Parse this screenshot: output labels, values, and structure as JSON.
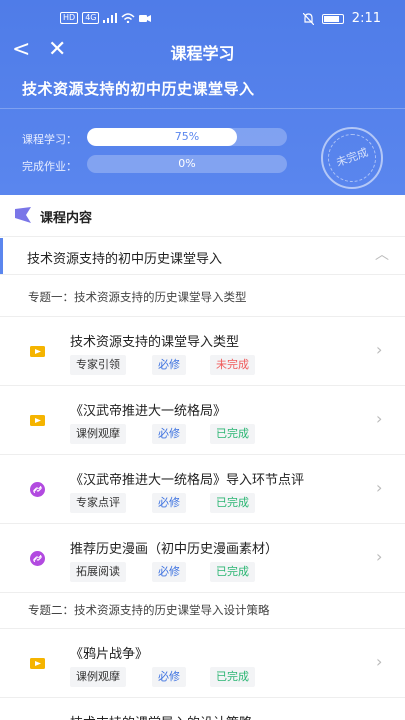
{
  "status_bar": {
    "chip1": "HD",
    "chip2": "4G",
    "time": "2:11"
  },
  "nav": {
    "back_glyph": "<",
    "close_glyph": "✕",
    "title": "课程学习"
  },
  "course": {
    "title": "技术资源支持的初中历史课堂导入",
    "progress": [
      {
        "label": "课程学习：",
        "value_text": "75%",
        "fraction": 0.75
      },
      {
        "label": "完成作业：",
        "value_text": "0%",
        "fraction": 0
      }
    ],
    "stamp": "未完成"
  },
  "section": {
    "title": "课程内容",
    "icon": "flag-icon"
  },
  "chapter": {
    "title": "技术资源支持的初中历史课堂导入",
    "chevron_glyph": "︿"
  },
  "topics": [
    {
      "label": "专题一：技术资源支持的历史课堂导入类型"
    },
    {
      "label": "专题二：技术资源支持的历史课堂导入设计策略"
    }
  ],
  "items": [
    {
      "title": "技术资源支持的课堂导入类型",
      "type_tag": "专家引领",
      "required_tag": "必修",
      "status": "未完成",
      "icon": "video-icon",
      "status_color": "#f05a5a"
    },
    {
      "title": "《汉武帝推进大一统格局》",
      "type_tag": "课例观摩",
      "required_tag": "必修",
      "status": "已完成",
      "icon": "video-icon",
      "status_color": "#2bb673"
    },
    {
      "title": "《汉武帝推进大一统格局》导入环节点评",
      "type_tag": "专家点评",
      "required_tag": "必修",
      "status": "已完成",
      "icon": "link-icon",
      "status_color": "#2bb673"
    },
    {
      "title": "推荐历史漫画（初中历史漫画素材）",
      "type_tag": "拓展阅读",
      "required_tag": "必修",
      "status": "已完成",
      "icon": "link-icon",
      "status_color": "#2bb673"
    },
    {
      "title": "《鸦片战争》",
      "type_tag": "课例观摩",
      "required_tag": "必修",
      "status": "已完成",
      "icon": "video-icon",
      "status_color": "#2bb673"
    },
    {
      "title": "技术支持的课堂导入的设计策略"
    }
  ],
  "chevron_glyph": "›",
  "colors": {
    "header_blue": "#5a86ee",
    "required_blue": "#3d72e0",
    "done_green": "#2bb673",
    "undone_red": "#f05a5a",
    "video_icon": "#f5b400",
    "link_icon": "#b24ae0"
  }
}
